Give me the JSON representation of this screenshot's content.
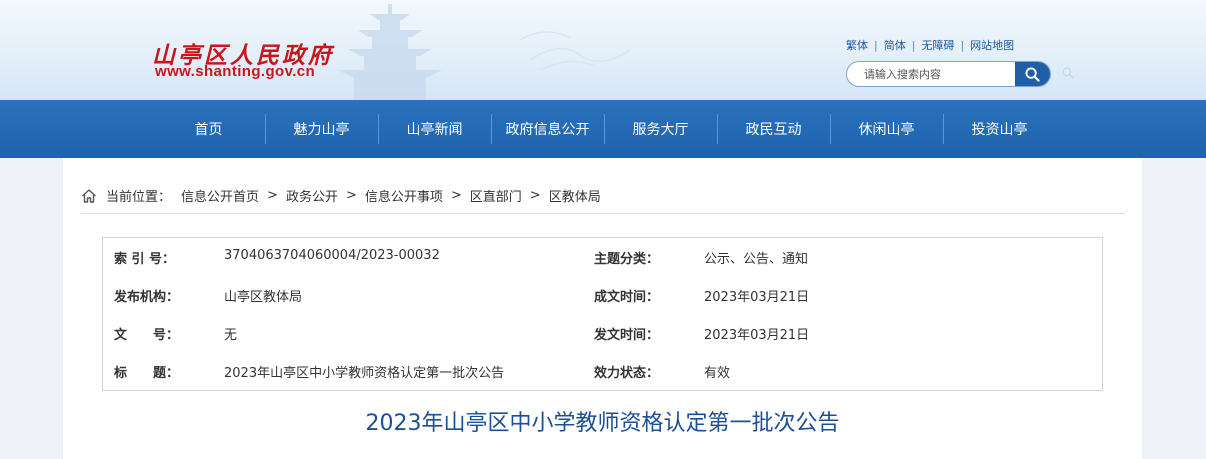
{
  "header": {
    "site_name": "山亭区人民政府",
    "site_url": "www.shanting.gov.cn",
    "top_links": [
      "繁体",
      "简体",
      "无障碍",
      "网站地图"
    ],
    "search": {
      "placeholder": "请输入搜索内容"
    }
  },
  "nav": {
    "items": [
      "首页",
      "魅力山亭",
      "山亭新闻",
      "政府信息公开",
      "服务大厅",
      "政民互动",
      "休闲山亭",
      "投资山亭"
    ]
  },
  "breadcrumb": {
    "label": "当前位置：",
    "items": [
      "信息公开首页",
      "政务公开",
      "信息公开事项",
      "区直部门",
      "区教体局"
    ],
    "separator": ">"
  },
  "meta": {
    "index_label": "索 引 号：",
    "index_value": "3704063704060004/2023-00032",
    "topic_label": "主题分类：",
    "topic_value": "公示、公告、通知",
    "publisher_label": "发布机构：",
    "publisher_value": "山亭区教体局",
    "created_label": "成文时间：",
    "created_value": "2023年03月21日",
    "docno_label": "文　　号：",
    "docno_value": "无",
    "issued_label": "发文时间：",
    "issued_value": "2023年03月21日",
    "title_label": "标　　题：",
    "title_value": "2023年山亭区中小学教师资格认定第一批次公告",
    "status_label": "效力状态：",
    "status_value": "有效"
  },
  "document": {
    "title": "2023年山亭区中小学教师资格认定第一批次公告"
  },
  "colors": {
    "brand_red": "#c8161d",
    "nav_blue": "#1f62ad",
    "title_blue": "#1c4f94"
  }
}
